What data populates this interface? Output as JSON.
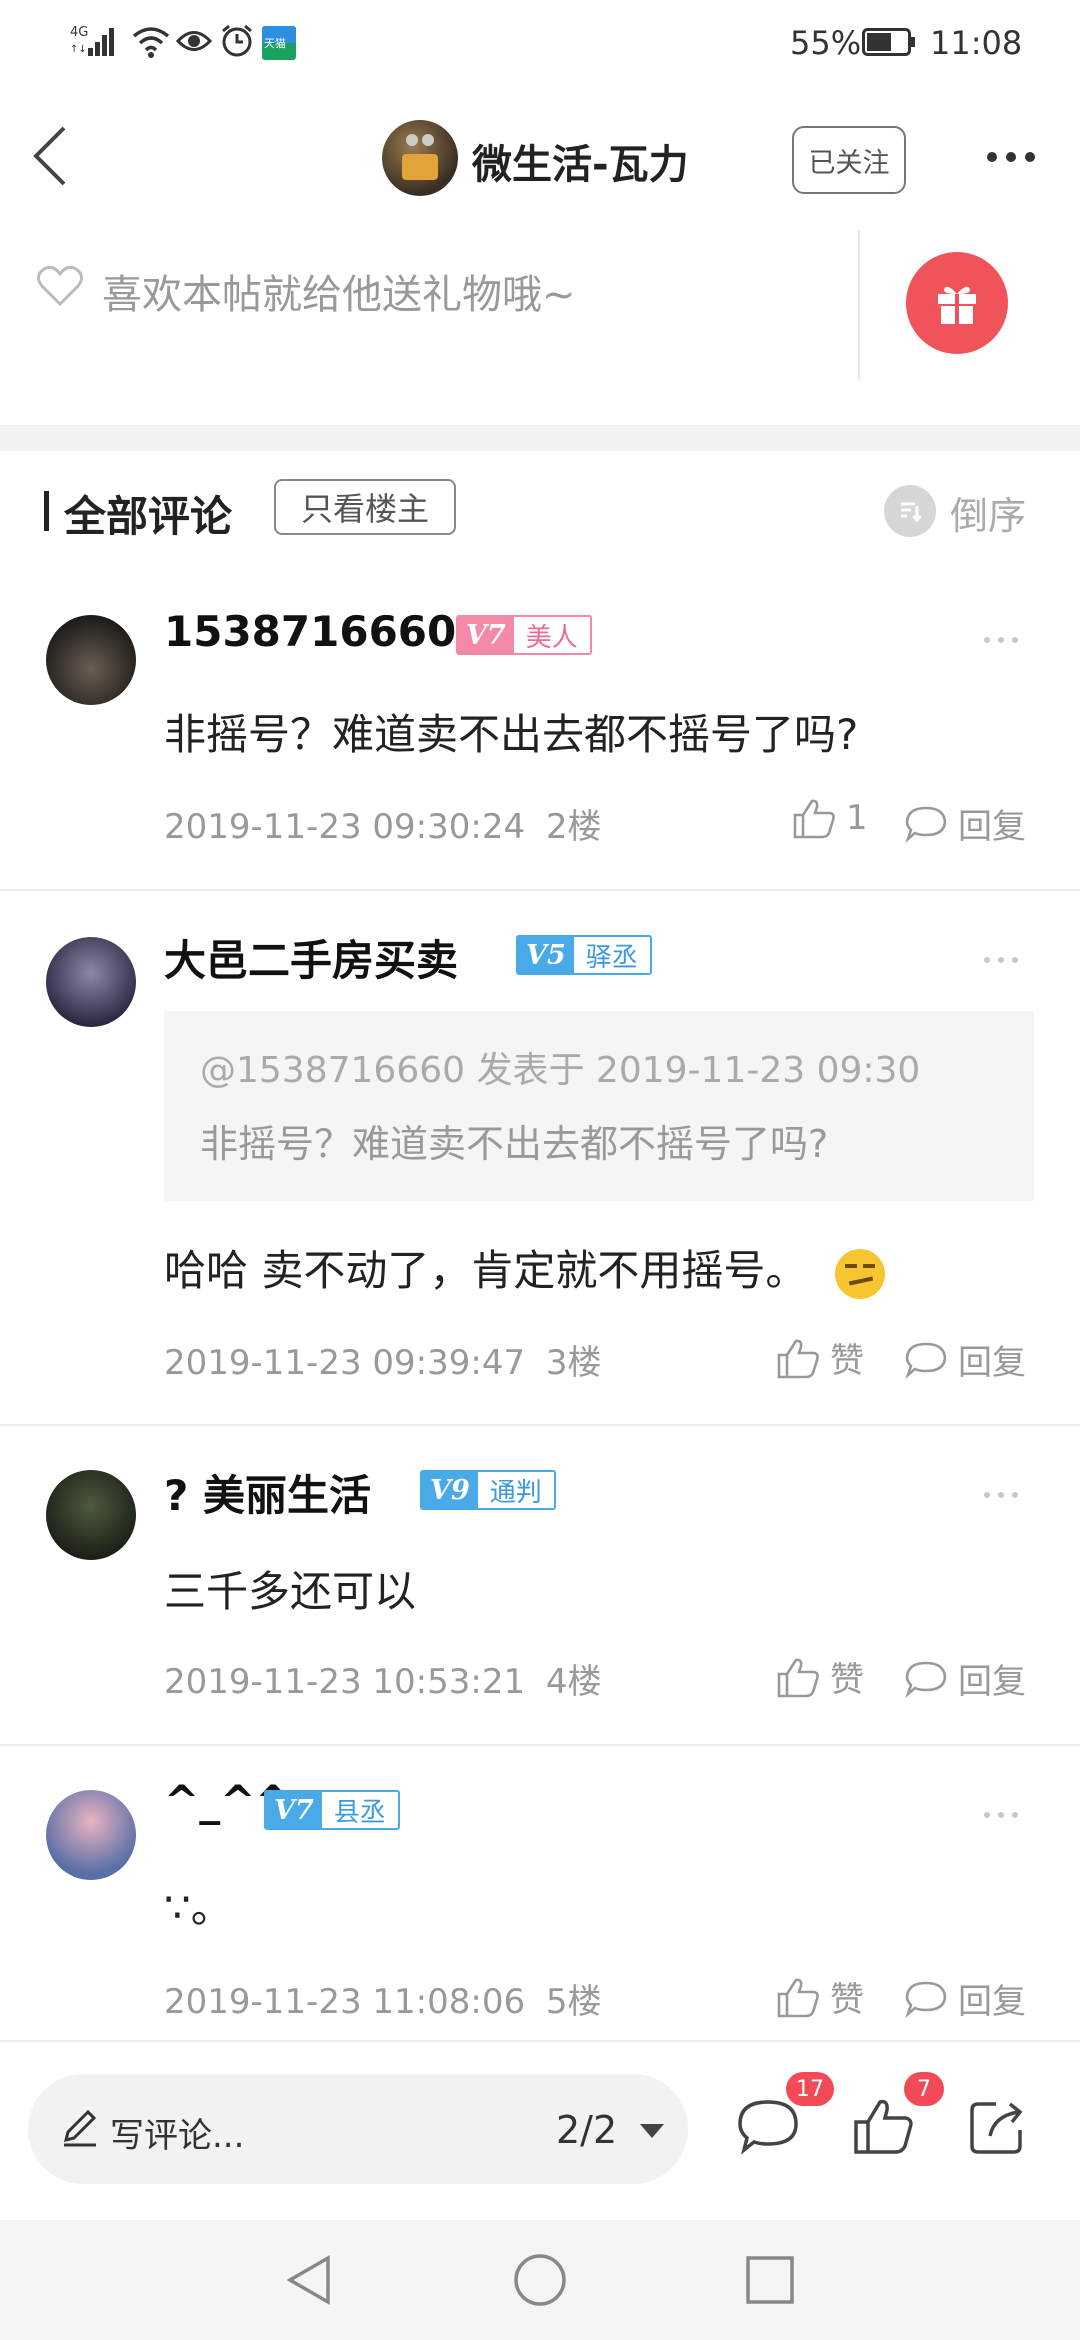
{
  "status_bar": {
    "network": "4G",
    "battery": "55%",
    "time": "11:08",
    "app_badge": "天猫"
  },
  "header": {
    "author_name": "微生活-瓦力",
    "follow_label": "已关注"
  },
  "gift": {
    "prompt": "喜欢本帖就给他送礼物哦~"
  },
  "comments_header": {
    "title": "全部评论",
    "filter_label": "只看楼主",
    "sort_label": "倒序"
  },
  "comments": [
    {
      "username": "1538716660",
      "level": "V7",
      "rank": "美人",
      "text": "非摇号？难道卖不出去都不摇号了吗?",
      "time": "2019-11-23 09:30:24",
      "floor": "2楼",
      "like": "1",
      "reply": "回复"
    },
    {
      "username": "大邑二手房买卖",
      "level": "V5",
      "rank": "驿丞",
      "quote_meta": "@1538716660 发表于 2019-11-23 09:30",
      "quote_text": "非摇号？难道卖不出去都不摇号了吗?",
      "text": "哈哈 卖不动了，肯定就不用摇号。",
      "time": "2019-11-23 09:39:47",
      "floor": "3楼",
      "like": "赞",
      "reply": "回复"
    },
    {
      "username": "? 美丽生活",
      "level": "V9",
      "rank": "通判",
      "text": "三千多还可以",
      "time": "2019-11-23 10:53:21",
      "floor": "4楼",
      "like": "赞",
      "reply": "回复"
    },
    {
      "username": "^_^^",
      "level": "V7",
      "rank": "县丞",
      "text": "∵。",
      "time": "2019-11-23 11:08:06",
      "floor": "5楼",
      "like": "赞",
      "reply": "回复"
    }
  ],
  "bottom_bar": {
    "placeholder": "写评论...",
    "page": "2/2",
    "comment_count": "17",
    "like_count": "7"
  },
  "colors": {
    "gift_red": "#f0545a",
    "badge_pink": "#f48aa8",
    "badge_blue": "#4aaae8",
    "count_red": "#f24b57"
  }
}
